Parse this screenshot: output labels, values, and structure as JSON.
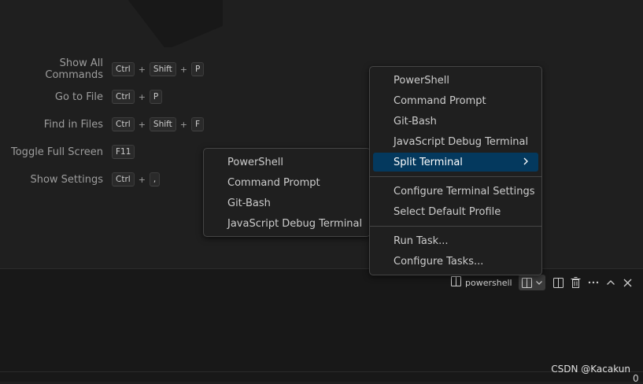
{
  "shortcuts": [
    {
      "label": "Show All Commands",
      "keys": [
        "Ctrl",
        "Shift",
        "P"
      ]
    },
    {
      "label": "Go to File",
      "keys": [
        "Ctrl",
        "P"
      ]
    },
    {
      "label": "Find in Files",
      "keys": [
        "Ctrl",
        "Shift",
        "F"
      ]
    },
    {
      "label": "Toggle Full Screen",
      "keys": [
        "F11"
      ]
    },
    {
      "label": "Show Settings",
      "keys": [
        "Ctrl",
        ","
      ]
    }
  ],
  "plus_sign": "+",
  "terminal": {
    "name": "powershell"
  },
  "main_menu": {
    "items": [
      "PowerShell",
      "Command Prompt",
      "Git-Bash",
      "JavaScript Debug Terminal"
    ],
    "split_terminal": "Split Terminal",
    "settings": [
      "Configure Terminal Settings",
      "Select Default Profile"
    ],
    "tasks": [
      "Run Task...",
      "Configure Tasks..."
    ]
  },
  "sub_menu": {
    "items": [
      "PowerShell",
      "Command Prompt",
      "Git-Bash",
      "JavaScript Debug Terminal"
    ]
  },
  "watermark": "CSDN @Kacakun",
  "statusbar_glyph": "0",
  "colors": {
    "menu_highlight": "#04395e",
    "background": "#1f1f1f",
    "panel": "#181818"
  }
}
